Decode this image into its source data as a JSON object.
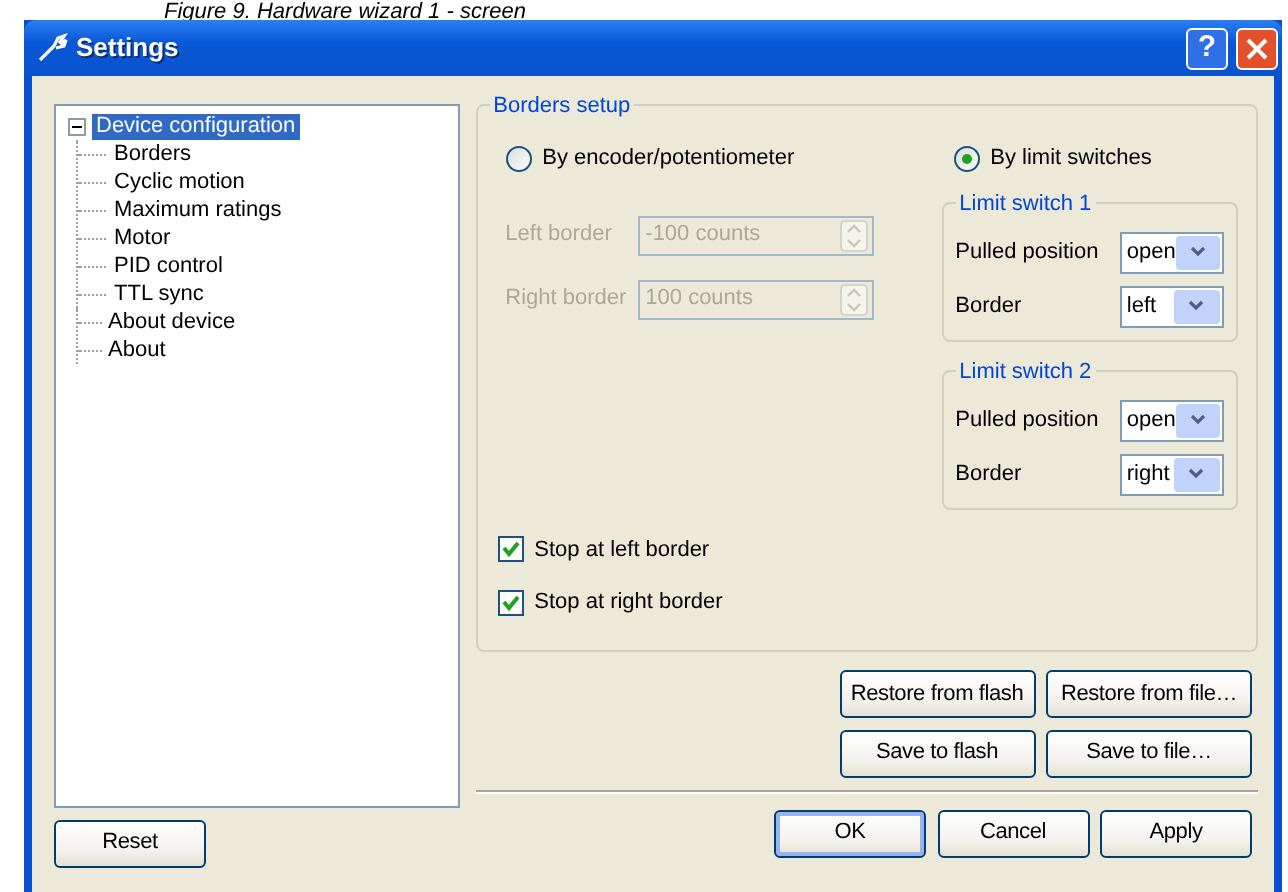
{
  "caption": "Figure 9. Hardware wizard 1 - screen",
  "window": {
    "title": "Settings",
    "help": "?"
  },
  "tree": [
    {
      "label": "Device configuration",
      "expanded": true,
      "selected": true,
      "children": [
        {
          "label": "Borders",
          "selected": false
        },
        {
          "label": "Cyclic motion",
          "selected": false
        },
        {
          "label": "Maximum ratings",
          "selected": false
        },
        {
          "label": "Motor",
          "selected": false
        },
        {
          "label": "PID control",
          "selected": false
        },
        {
          "label": "TTL sync",
          "selected": false
        }
      ]
    },
    {
      "label": "About device",
      "selected": false
    },
    {
      "label": "About",
      "selected": false
    }
  ],
  "reset_button": "Reset",
  "borders_setup": {
    "title": "Borders setup",
    "modes": [
      {
        "label": "By encoder/potentiometer",
        "selected": false
      },
      {
        "label": "By limit switches",
        "selected": true
      }
    ],
    "fields": [
      {
        "label": "Left border",
        "value": "-100 counts",
        "disabled": true
      },
      {
        "label": "Right border",
        "value": "100 counts",
        "disabled": true
      }
    ],
    "limit_switches": [
      {
        "title": "Limit switch 1",
        "rows": [
          {
            "label": "Pulled position",
            "value": "open"
          },
          {
            "label": "Border",
            "value": "left"
          }
        ]
      },
      {
        "title": "Limit switch 2",
        "rows": [
          {
            "label": "Pulled position",
            "value": "open"
          },
          {
            "label": "Border",
            "value": "right"
          }
        ]
      }
    ],
    "checks": [
      {
        "label": "Stop at left border",
        "checked": true
      },
      {
        "label": "Stop at right border",
        "checked": true
      }
    ]
  },
  "file_buttons": [
    [
      "Restore from flash",
      "Restore from file…"
    ],
    [
      "Save to flash",
      "Save to file…"
    ]
  ],
  "dialog_buttons": [
    {
      "label": "OK",
      "default": true
    },
    {
      "label": "Cancel",
      "default": false
    },
    {
      "label": "Apply",
      "default": false
    }
  ]
}
